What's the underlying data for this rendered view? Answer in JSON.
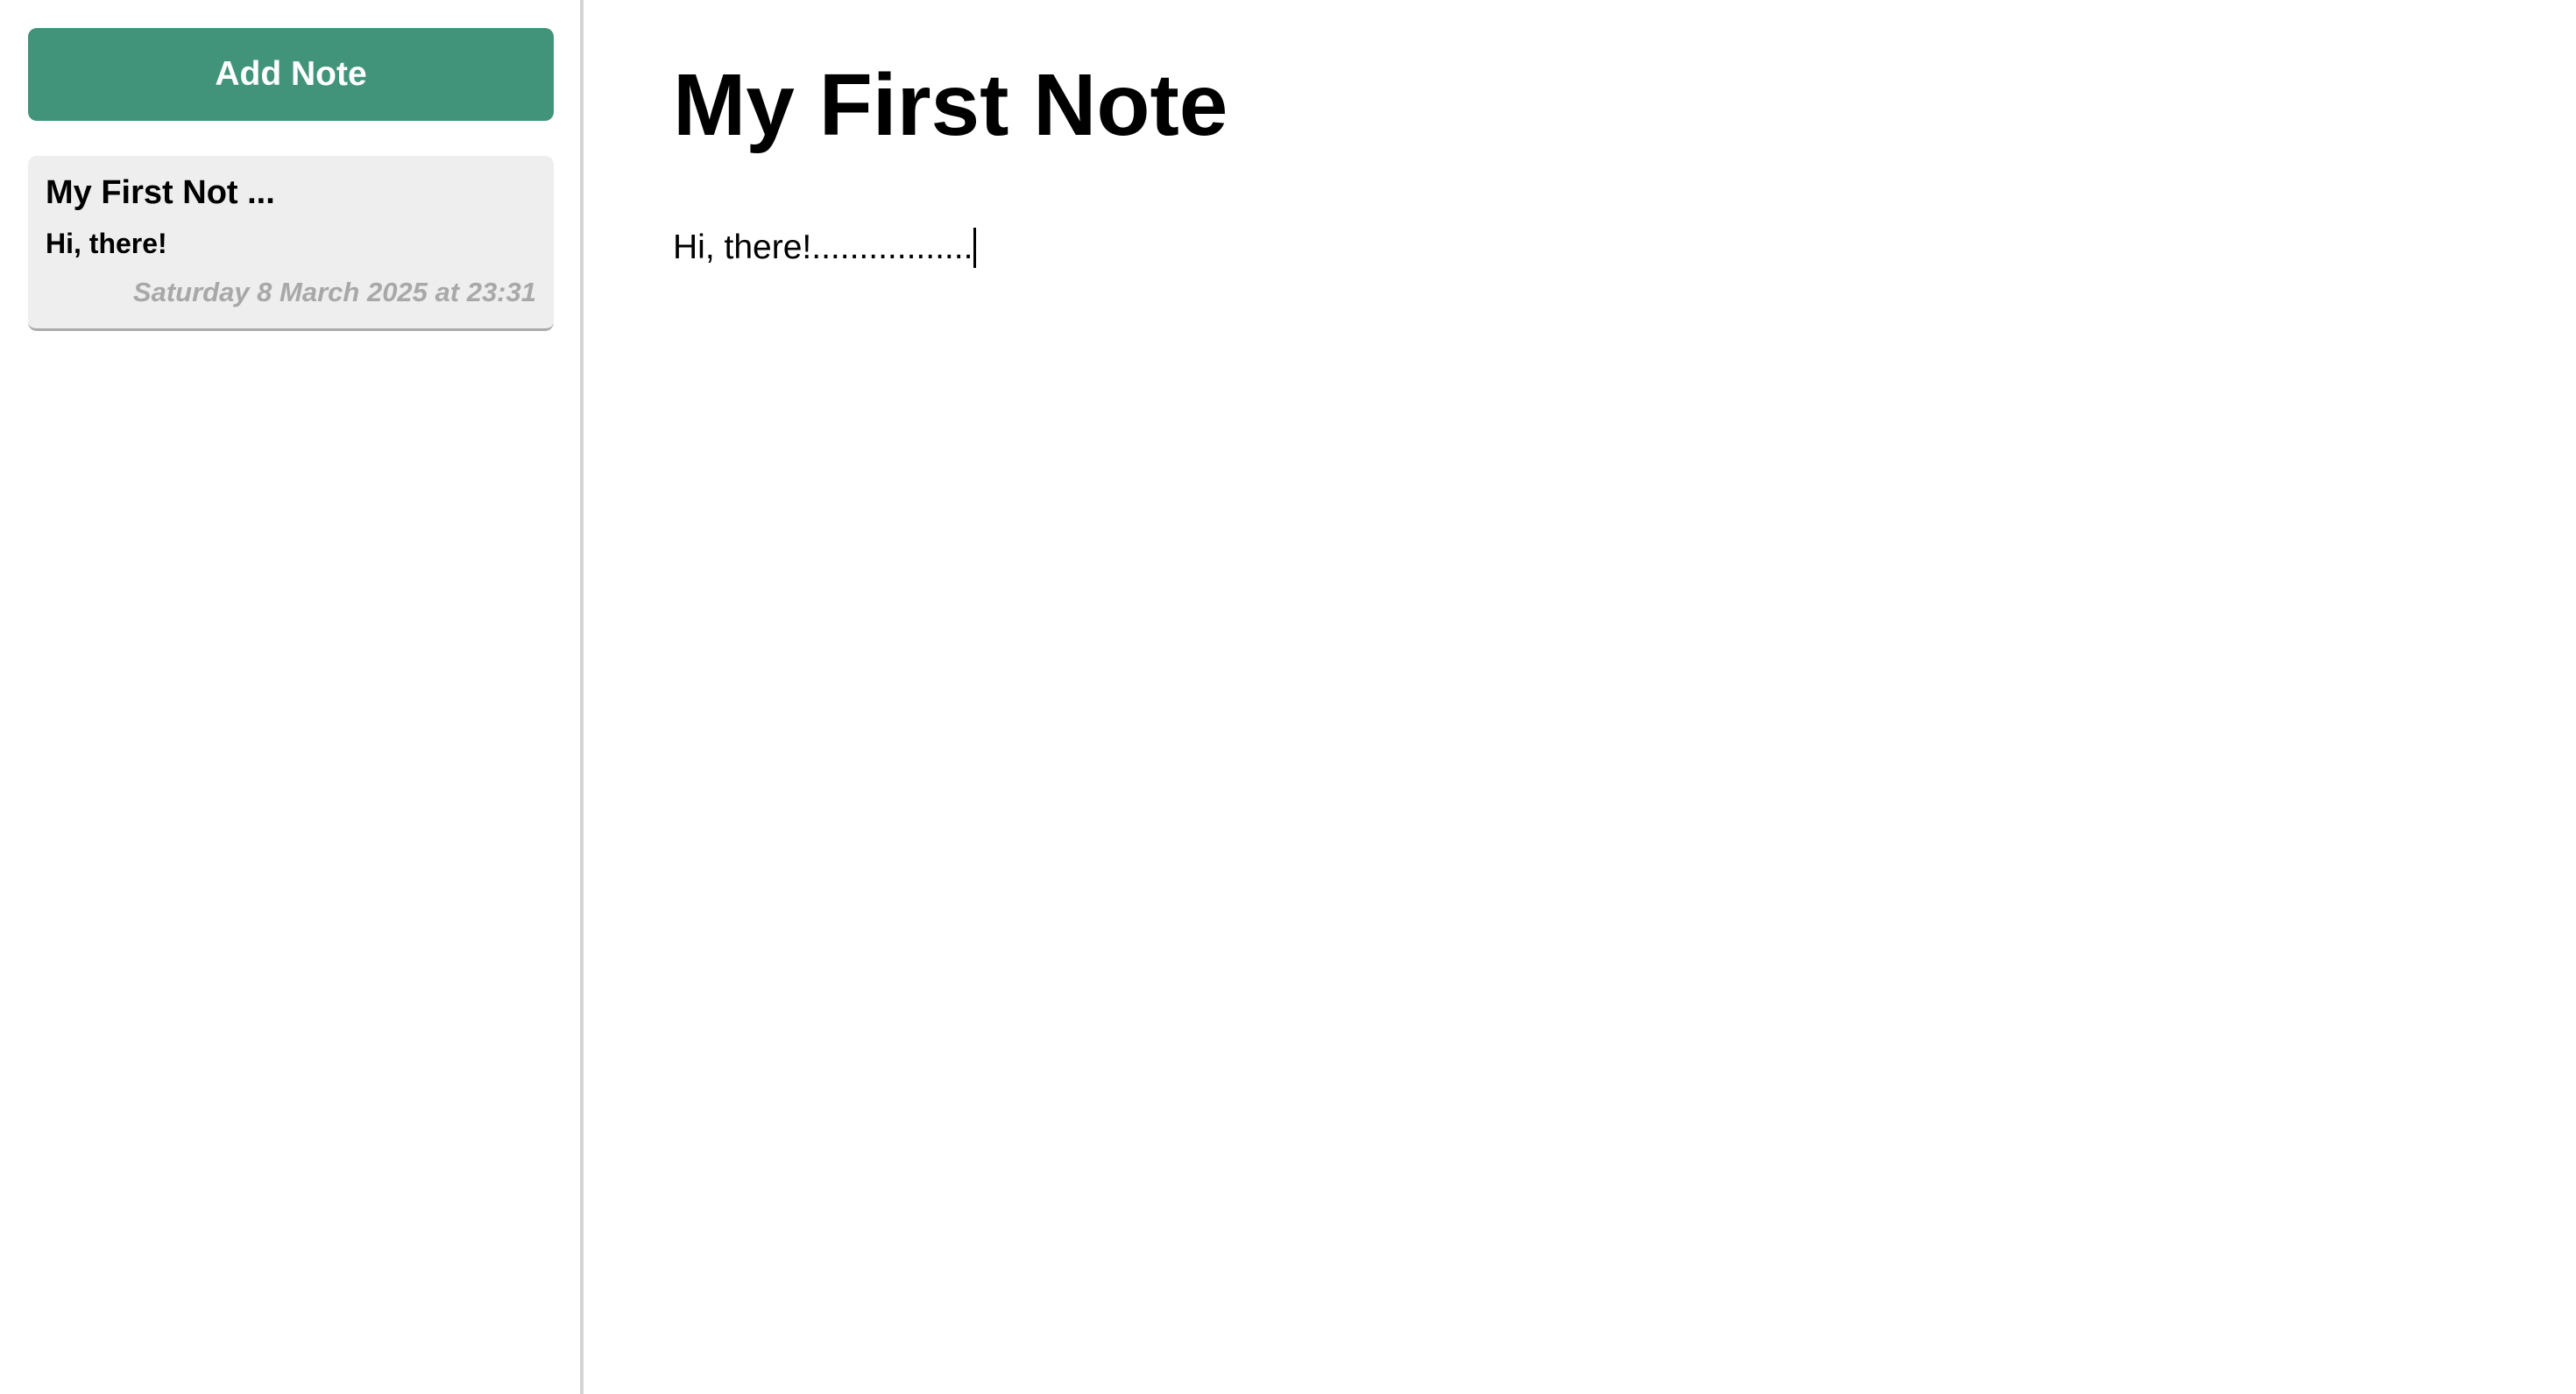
{
  "sidebar": {
    "add_note_label": "Add Note",
    "notes": [
      {
        "title": "My First Not ...",
        "preview": "Hi, there!",
        "date": "Saturday 8 March 2025 at 23:31"
      }
    ]
  },
  "editor": {
    "title": "My First Note",
    "body": "Hi, there!................."
  },
  "colors": {
    "accent": "#41947a",
    "card_background": "#eeeeee",
    "date_text": "#a8a8a8",
    "divider": "#d4d4d4"
  }
}
